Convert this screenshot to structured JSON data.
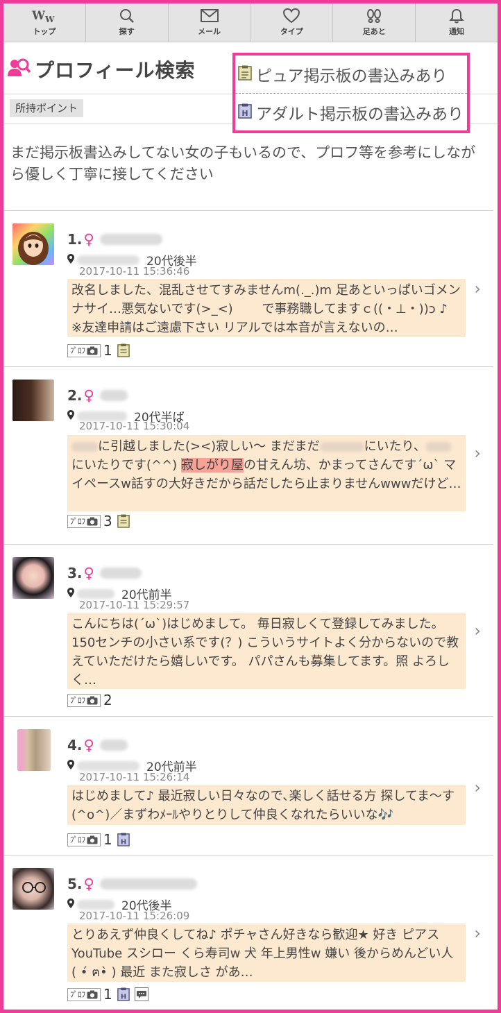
{
  "nav": [
    {
      "label": "トップ",
      "icon": "ww-logo-icon"
    },
    {
      "label": "探す",
      "icon": "search-icon"
    },
    {
      "label": "メール",
      "icon": "mail-icon"
    },
    {
      "label": "タイプ",
      "icon": "heart-icon"
    },
    {
      "label": "足あと",
      "icon": "footprints-icon"
    },
    {
      "label": "通知",
      "icon": "bell-icon"
    }
  ],
  "page_title": "プロフィール検索",
  "points_label": "所持ポイント",
  "legend": {
    "pure": "ピュア掲示板の書込みあり",
    "adult": "アダルト掲示板の書込みあり"
  },
  "notice": "まだ掲示板書込みしてない女の子もいるので、プロフ等を参考にしながら優しく丁寧に接してください",
  "colors": {
    "accent": "#ee3c98",
    "message_bg": "#fde8d0",
    "highlight": "#f6a296"
  },
  "list": [
    {
      "num": "1.",
      "gender": "♀",
      "age": "20代後半",
      "date": "2017-10-11 15:36:46",
      "prof_label": "ﾌﾟﾛﾌ",
      "photo_count": "1",
      "message": "改名しました、混乱させてすみませんm(._.)m 足あといっぱいゴメンナサイ…悪気ないです(>_<) 　　で事務職してますｃ((・⊥・))ɔ ♪ ※友達申請はご遠慮下さい リアルでは本音が言えないの…"
    },
    {
      "num": "2.",
      "gender": "♀",
      "age": "20代半ば",
      "date": "2017-10-11 15:30:04",
      "prof_label": "ﾌﾟﾛﾌ",
      "photo_count": "3",
      "message_a": "に引越しました(><)寂しい〜 まだまだ",
      "message_b": "にいたり、",
      "message_c": "にいたりです(^^) ",
      "message_hl": "寂しがり屋",
      "message_d": "の甘えん坊、かまってさんです´ω` マイペースw話すの大好きだから話だしたら止まりませんwwwだけど…"
    },
    {
      "num": "3.",
      "gender": "♀",
      "age": "20代前半",
      "date": "2017-10-11 15:29:57",
      "prof_label": "ﾌﾟﾛﾌ",
      "photo_count": "2",
      "message": "こんにちは(´ω`)はじめまして。 毎日寂しくて登録してみました。 150センチの小さい系です(？) こういうサイトよく分からないので教えていただけたら嬉しいです。 パパさんも募集してます。照 よろしく…"
    },
    {
      "num": "4.",
      "gender": "♀",
      "age": "20代前半",
      "date": "2017-10-11 15:26:14",
      "prof_label": "ﾌﾟﾛﾌ",
      "photo_count": "1",
      "message": "はじめまして♪ 最近寂しい日々なので､楽しく話せる方 探してま〜す(^o^)／まずわﾒｰﾙやりとりして仲良くなれたらいいな🎶"
    },
    {
      "num": "5.",
      "gender": "♀",
      "age": "20代後半",
      "date": "2017-10-11 15:26:09",
      "prof_label": "ﾌﾟﾛﾌ",
      "photo_count": "1",
      "message": "とりあえず仲良くしてね♪ ポチャさん好きなら歓迎★ 好き ピアス YouTube スシロー くら寿司w 犬 年上男性w 嫌い 後からめんどい人 ( •́ ฅ•̀ ) 最近 また寂しさ があ…"
    }
  ]
}
